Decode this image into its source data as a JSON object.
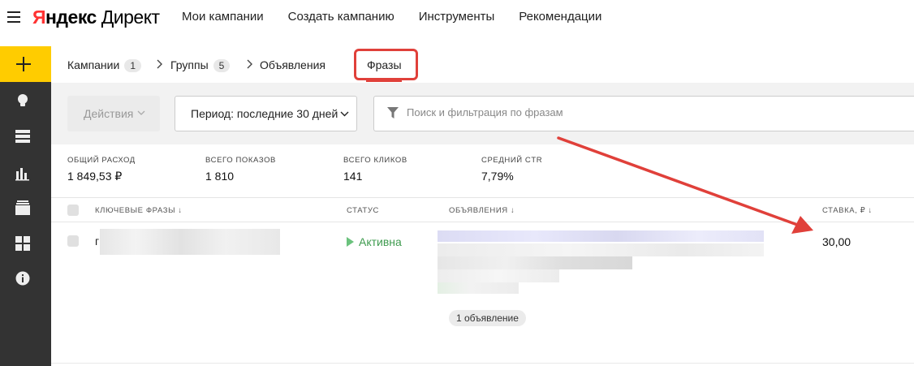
{
  "header": {
    "logo_brand": "Яндекс",
    "logo_product": "Директ",
    "nav": [
      "Мои кампании",
      "Создать кампанию",
      "Инструменты",
      "Рекомендации"
    ]
  },
  "breadcrumbs": {
    "campaigns_label": "Кампании",
    "campaigns_count": "1",
    "groups_label": "Группы",
    "groups_count": "5",
    "ads_label": "Объявления",
    "phrases_tab": "Фразы"
  },
  "toolbar": {
    "actions_label": "Действия",
    "period_label": "Период: последние 30 дней",
    "search_placeholder": "Поиск и фильтрация по фразам"
  },
  "stats": [
    {
      "label": "Общий расход",
      "value": "1 849,53 ₽"
    },
    {
      "label": "Всего показов",
      "value": "1 810"
    },
    {
      "label": "Всего кликов",
      "value": "141"
    },
    {
      "label": "Средний CTR",
      "value": "7,79%"
    }
  ],
  "table": {
    "columns": {
      "keywords": "Ключевые фразы ↓",
      "status": "Статус",
      "ads": "Объявления ↓",
      "bid": "Ставка, ₽ ↓"
    },
    "row": {
      "keyword_initial": "г",
      "status": "Активна",
      "ads_count": "1 объявление",
      "bid": "30,00"
    }
  },
  "colors": {
    "accent_yellow": "#ffcc00",
    "sidebar": "#333333",
    "highlight_red": "#e0403a",
    "status_green": "#3f9b4f"
  },
  "icons": {
    "sidebar": [
      "plus-icon",
      "lightbulb-icon",
      "list-icon",
      "bar-chart-icon",
      "stack-icon",
      "grid-icon",
      "info-icon"
    ]
  }
}
